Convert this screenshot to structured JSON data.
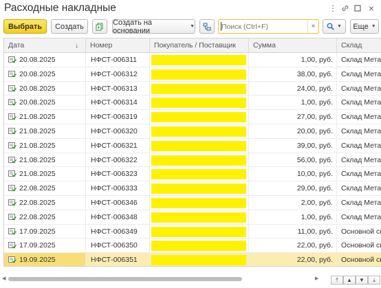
{
  "window": {
    "title": "Расходные накладные",
    "controls": [
      {
        "name": "more-icon",
        "glyph": "⋮"
      },
      {
        "name": "link-icon",
        "glyph": "🔗"
      },
      {
        "name": "maximize-icon",
        "glyph": "□"
      },
      {
        "name": "close-icon",
        "glyph": "×"
      }
    ]
  },
  "toolbar": {
    "select_label": "Выбрать",
    "create_label": "Создать",
    "create_basis_label": "Создать на основании",
    "search_placeholder": "Поиск (Ctrl+F)",
    "search_value": "",
    "more_label": "Еще"
  },
  "table": {
    "columns": [
      "Дата",
      "Номер",
      "Покупатель / Поставщик",
      "Сумма",
      "Склад"
    ],
    "sort_indicator": "↓",
    "rows": [
      {
        "date": "20.08.2025",
        "number": "НФСТ-006311",
        "sum": "1,00",
        "currency": "руб.",
        "warehouse": "Склад Металл"
      },
      {
        "date": "20.08.2025",
        "number": "НФСТ-006312",
        "sum": "38,00",
        "currency": "руб.",
        "warehouse": "Склад Металл"
      },
      {
        "date": "20.08.2025",
        "number": "НФСТ-006313",
        "sum": "24,00",
        "currency": "руб.",
        "warehouse": "Склад Металл"
      },
      {
        "date": "20.08.2025",
        "number": "НФСТ-006314",
        "sum": "1,00",
        "currency": "руб.",
        "warehouse": "Склад Металл"
      },
      {
        "date": "21.08.2025",
        "number": "НФСТ-006319",
        "sum": "27,00",
        "currency": "руб.",
        "warehouse": "Склад Металл"
      },
      {
        "date": "21.08.2025",
        "number": "НФСТ-006320",
        "sum": "20,00",
        "currency": "руб.",
        "warehouse": "Склад Металл"
      },
      {
        "date": "21.08.2025",
        "number": "НФСТ-006321",
        "sum": "39,00",
        "currency": "руб.",
        "warehouse": "Склад Металл"
      },
      {
        "date": "21.08.2025",
        "number": "НФСТ-006322",
        "sum": "56,00",
        "currency": "руб.",
        "warehouse": "Склад Металл"
      },
      {
        "date": "21.08.2025",
        "number": "НФСТ-006323",
        "sum": "10,00",
        "currency": "руб.",
        "warehouse": "Склад Металл"
      },
      {
        "date": "22.08.2025",
        "number": "НФСТ-006333",
        "sum": "29,00",
        "currency": "руб.",
        "warehouse": "Склад Металл"
      },
      {
        "date": "22.08.2025",
        "number": "НФСТ-006346",
        "sum": "2,00",
        "currency": "руб.",
        "warehouse": "Склад Металл"
      },
      {
        "date": "22.08.2025",
        "number": "НФСТ-006348",
        "sum": "1,00",
        "currency": "руб.",
        "warehouse": "Склад Металл"
      },
      {
        "date": "17.09.2025",
        "number": "НФСТ-006349",
        "sum": "11,00",
        "currency": "руб.",
        "warehouse": "Основной скл"
      },
      {
        "date": "17.09.2025",
        "number": "НФСТ-006350",
        "sum": "22,00",
        "currency": "руб.",
        "warehouse": "Основной скл"
      },
      {
        "date": "19.09.2025",
        "number": "НФСТ-006351",
        "sum": "22,00",
        "currency": "руб.",
        "warehouse": "Основной скл",
        "selected": true
      }
    ],
    "redaction_color": "#fff200"
  },
  "colors": {
    "primary_button": "#f3cf1c",
    "selected_row": "#fbedb0",
    "search_border": "#e8c232"
  }
}
